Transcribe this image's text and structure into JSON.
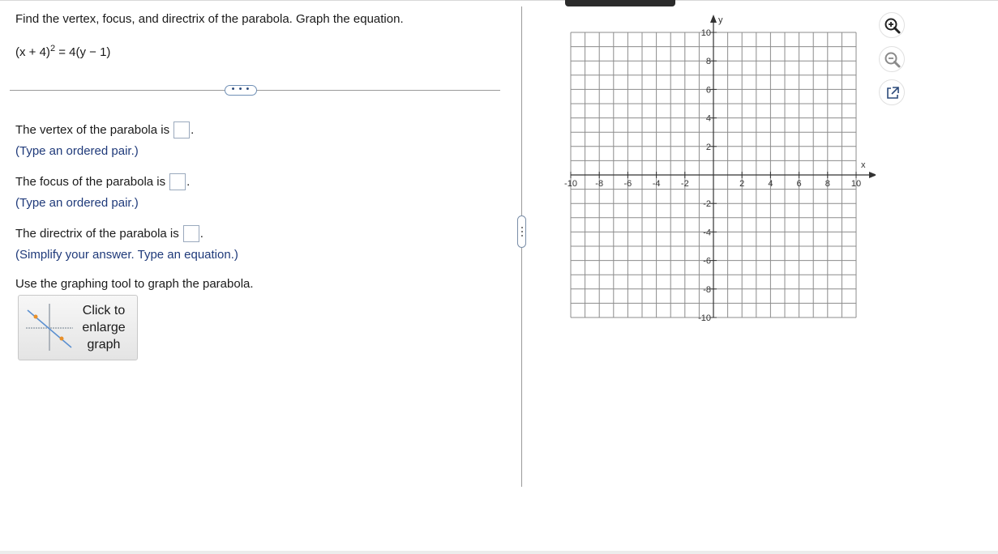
{
  "question": {
    "prompt": "Find the vertex, focus, and directrix of the parabola. Graph the equation.",
    "equation_pre": "(x + 4)",
    "equation_exp": "2",
    "equation_post": " = 4(y − 1)"
  },
  "more_button": "• • •",
  "answers": {
    "vertex_label": "The vertex of the parabola is",
    "vertex_hint": "(Type an ordered pair.)",
    "focus_label": "The focus of the parabola is",
    "focus_hint": "(Type an ordered pair.)",
    "directrix_label": "The directrix of the parabola is",
    "directrix_hint": "(Simplify your answer. Type an equation.)",
    "period": "."
  },
  "graph_instruction": "Use the graphing tool to graph the parabola.",
  "graph_button": {
    "line1": "Click to",
    "line2": "enlarge",
    "line3": "graph"
  },
  "graph": {
    "x_axis_label": "x",
    "y_axis_label": "y",
    "x_min": -10,
    "x_max": 10,
    "y_min": -10,
    "y_max": 10,
    "grid_step": 1,
    "x_tick_labels": [
      "-10",
      "-8",
      "-6",
      "-4",
      "-2",
      "2",
      "4",
      "6",
      "8",
      "10"
    ],
    "y_tick_labels": [
      "10",
      "8",
      "6",
      "4",
      "2",
      "-2",
      "-4",
      "-6",
      "-8",
      "-10"
    ]
  },
  "tools": {
    "zoom_in": "zoom-in-icon",
    "zoom_out": "zoom-out-icon",
    "popout": "popout-icon"
  },
  "colors": {
    "accent": "#2c4a7a",
    "hint": "#1f3a7a",
    "grid": "#8c8c8c"
  }
}
